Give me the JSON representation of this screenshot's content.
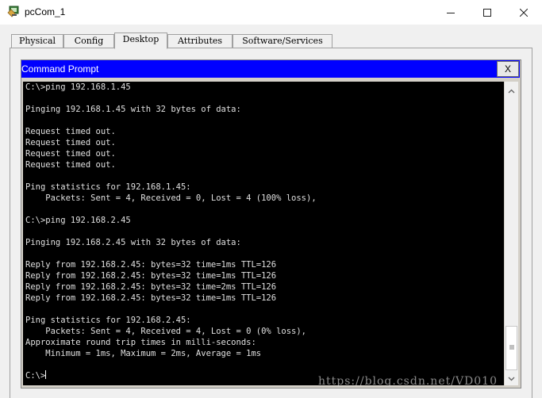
{
  "window": {
    "title": "pcCom_1"
  },
  "tabs": [
    {
      "label": "Physical",
      "active": false
    },
    {
      "label": "Config",
      "active": false
    },
    {
      "label": "Desktop",
      "active": true
    },
    {
      "label": "Attributes",
      "active": false
    },
    {
      "label": "Software/Services",
      "active": false
    }
  ],
  "command_prompt": {
    "title": "Command Prompt",
    "close_label": "X",
    "lines": [
      "C:\\>ping 192.168.1.45",
      "",
      "Pinging 192.168.1.45 with 32 bytes of data:",
      "",
      "Request timed out.",
      "Request timed out.",
      "Request timed out.",
      "Request timed out.",
      "",
      "Ping statistics for 192.168.1.45:",
      "    Packets: Sent = 4, Received = 0, Lost = 4 (100% loss),",
      "",
      "C:\\>ping 192.168.2.45",
      "",
      "Pinging 192.168.2.45 with 32 bytes of data:",
      "",
      "Reply from 192.168.2.45: bytes=32 time=1ms TTL=126",
      "Reply from 192.168.2.45: bytes=32 time=1ms TTL=126",
      "Reply from 192.168.2.45: bytes=32 time=2ms TTL=126",
      "Reply from 192.168.2.45: bytes=32 time=1ms TTL=126",
      "",
      "Ping statistics for 192.168.2.45:",
      "    Packets: Sent = 4, Received = 4, Lost = 0 (0% loss),",
      "Approximate round trip times in milli-seconds:",
      "    Minimum = 1ms, Maximum = 2ms, Average = 1ms",
      "",
      "C:\\>"
    ]
  },
  "watermark": "https://blog.csdn.net/VD010",
  "icons": {
    "app": "packet-tracer-pc-icon",
    "minimize": "minimize-icon",
    "maximize": "maximize-icon",
    "close": "close-icon",
    "scroll_up": "arrow-up-icon",
    "scroll_down": "arrow-down-icon"
  },
  "colors": {
    "cmd_header": "#0000ff",
    "terminal_bg": "#000000",
    "terminal_text": "#e0e0e0"
  }
}
